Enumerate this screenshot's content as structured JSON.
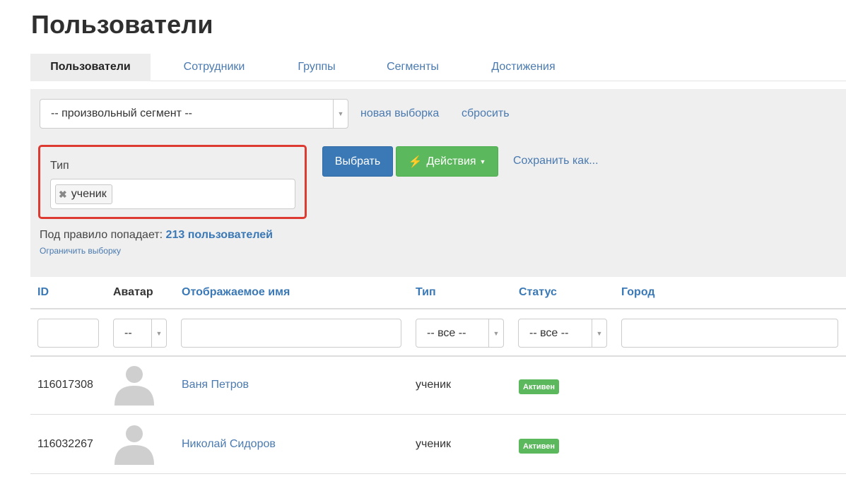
{
  "page": {
    "title": "Пользователи"
  },
  "tabs": [
    {
      "label": "Пользователи",
      "active": true
    },
    {
      "label": "Сотрудники",
      "active": false
    },
    {
      "label": "Группы",
      "active": false
    },
    {
      "label": "Сегменты",
      "active": false
    },
    {
      "label": "Достижения",
      "active": false
    }
  ],
  "filter": {
    "segment_select": {
      "value": "-- произвольный сегмент --"
    },
    "new_selection_link": "новая выборка",
    "reset_link": "сбросить",
    "type_field": {
      "label": "Тип",
      "tags": [
        "ученик"
      ]
    },
    "select_button": "Выбрать",
    "actions_button": "Действия",
    "save_as_link": "Сохранить как...",
    "match_prefix": "Под правило попадает:",
    "match_count": "213 пользователей",
    "limit_link": "Ограничить выборку",
    "highlight_color": "#dd3a32"
  },
  "table": {
    "columns": [
      "ID",
      "Аватар",
      "Отображаемое имя",
      "Тип",
      "Статус",
      "Город"
    ],
    "filters": {
      "id": "",
      "avatar": "--",
      "name": "",
      "type": "-- все --",
      "status": "-- все --",
      "city": ""
    },
    "rows": [
      {
        "id": "116017308",
        "avatar": "avatar-placeholder-icon",
        "name": "Ваня Петров",
        "type": "ученик",
        "status": "Активен",
        "city": ""
      },
      {
        "id": "116032267",
        "avatar": "avatar-placeholder-icon",
        "name": "Николай Сидоров",
        "type": "ученик",
        "status": "Активен",
        "city": ""
      }
    ]
  },
  "colors": {
    "primary": "#3a78b6",
    "success": "#5cb85c",
    "link": "#4a7ab0",
    "panel_bg": "#efefef"
  }
}
